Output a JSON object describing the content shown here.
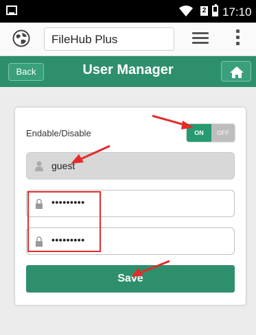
{
  "status_bar": {
    "time": "17:10",
    "sim_label": "2"
  },
  "app_bar": {
    "title": "FileHub Plus",
    "icons": [
      "globe-icon",
      "menu-lines-icon",
      "overflow-menu-icon"
    ]
  },
  "header": {
    "back_label": "Back",
    "title": "User Manager",
    "home_icon": "home-icon"
  },
  "form": {
    "toggle_label": "Endable/Disable",
    "toggle_on_label": "ON",
    "toggle_off_label": "OFF",
    "toggle_state": "on",
    "username_value": "guest",
    "password_value": "•••••••••",
    "confirm_password_value": "•••••••••",
    "save_label": "Save"
  },
  "colors": {
    "accent_green": "#2e8f6c",
    "annotation_red": "#e32b2b"
  }
}
